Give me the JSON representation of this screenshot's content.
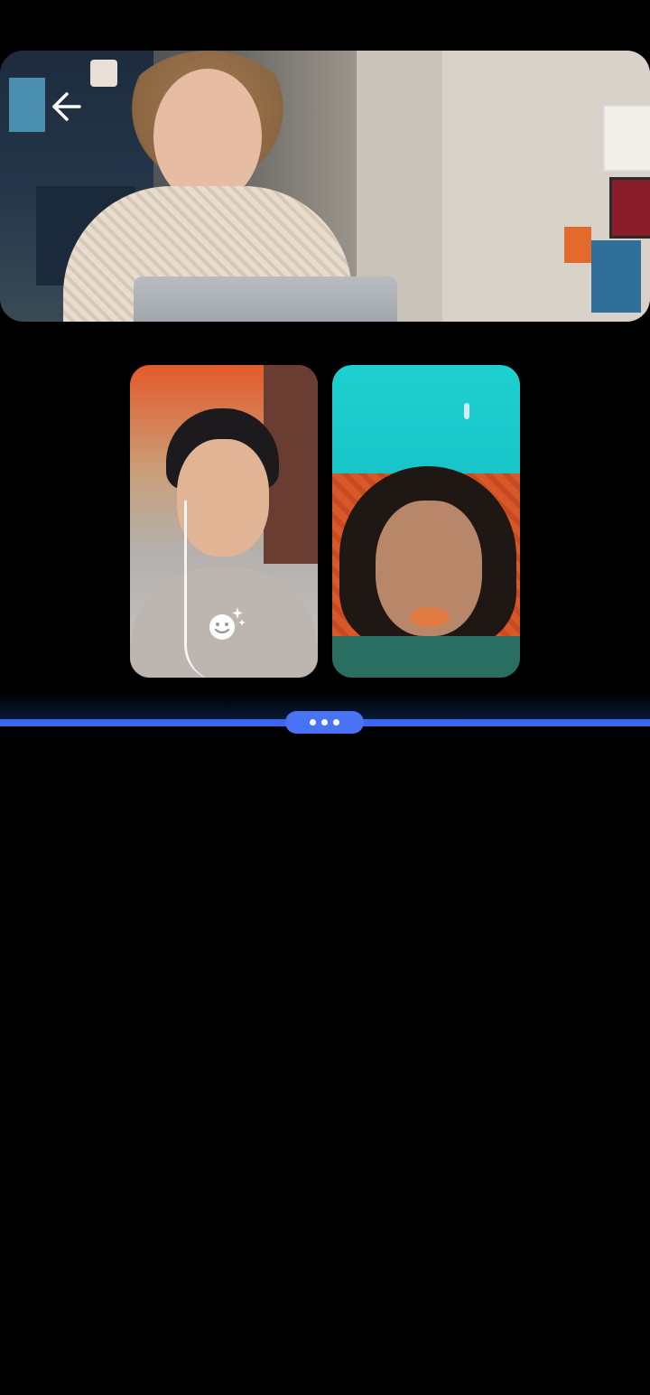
{
  "call": {
    "main_video": {
      "participant": "main-participant"
    },
    "tiles": [
      {
        "participant": "participant-1",
        "effects_icon": "face-sparkle-icon"
      },
      {
        "participant": "participant-2"
      }
    ],
    "toolbar": {
      "back_icon": "arrow-left-icon",
      "handle_icon": "more-dots-icon"
    },
    "colors": {
      "background": "#000000",
      "accent": "#3c66f0"
    }
  }
}
